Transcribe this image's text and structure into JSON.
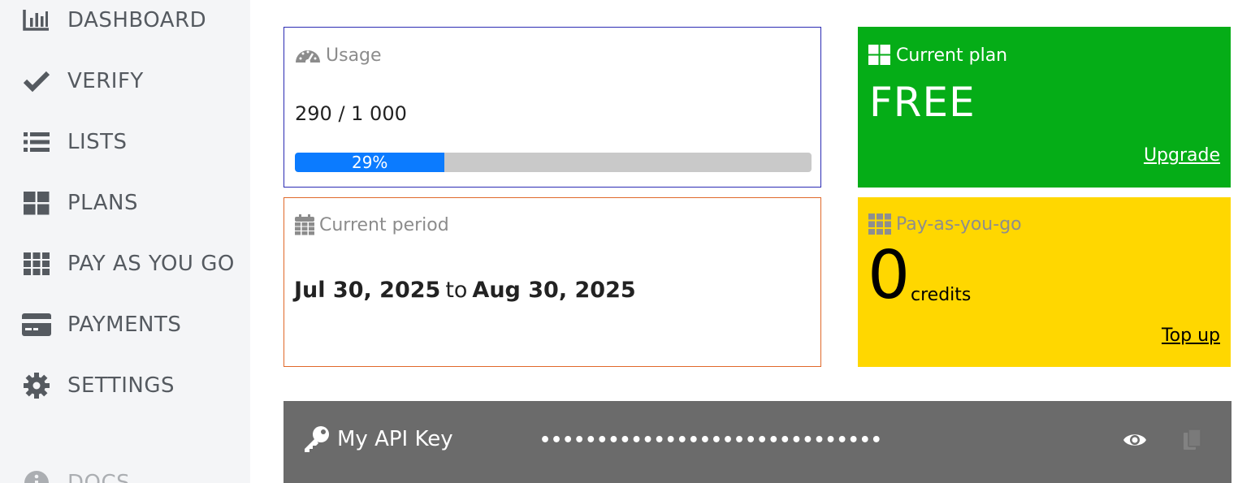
{
  "sidebar": {
    "items": [
      {
        "label": "DASHBOARD",
        "icon": "bar-chart-icon"
      },
      {
        "label": "VERIFY",
        "icon": "check-icon"
      },
      {
        "label": "LISTS",
        "icon": "list-icon"
      },
      {
        "label": "PLANS",
        "icon": "grid-large-icon"
      },
      {
        "label": "PAY AS YOU GO",
        "icon": "grid-small-icon"
      },
      {
        "label": "PAYMENTS",
        "icon": "credit-card-icon"
      },
      {
        "label": "SETTINGS",
        "icon": "gear-icon"
      },
      {
        "label": "DOCS",
        "icon": "info-icon"
      }
    ]
  },
  "usage": {
    "title": "Usage",
    "value": "290 / 1 000",
    "progress_percent": 29,
    "progress_label": "29%",
    "icon": "speedometer-icon"
  },
  "period": {
    "title": "Current period",
    "start": "Jul 30, 2025",
    "connector": "to",
    "end": "Aug 30, 2025",
    "icon": "calendar-icon"
  },
  "plan": {
    "title": "Current plan",
    "name": "FREE",
    "link": "Upgrade",
    "icon": "windows-grid-icon",
    "color": "#05ad17"
  },
  "payg": {
    "title": "Pay-as-you-go",
    "count": "0",
    "unit": "credits",
    "link": "Top up",
    "icon": "grid-small-icon",
    "color": "#ffd700"
  },
  "api": {
    "title": "My API Key",
    "masked_key": "••••••••••••••••••••••••••••••",
    "icon": "key-icon",
    "show_icon": "eye-icon",
    "copy_icon": "copy-icon"
  }
}
